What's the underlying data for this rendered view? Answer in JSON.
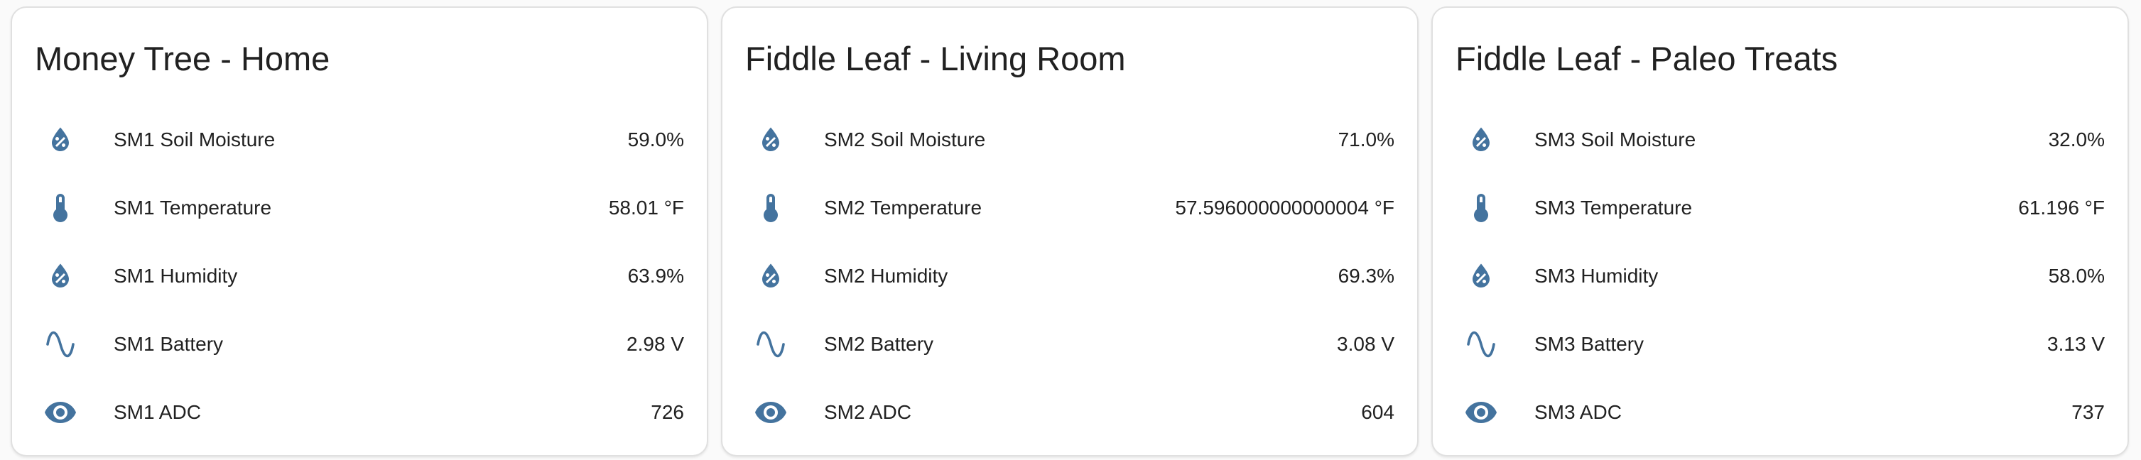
{
  "theme": {
    "icon_color": "#44739e",
    "card_background": "#ffffff",
    "page_background": "#fafafa",
    "card_border": "#e0e0e0",
    "text_color": "#212121"
  },
  "cards": [
    {
      "title": "Money Tree - Home",
      "rows": [
        {
          "icon": "water-percent-icon",
          "label": "SM1 Soil Moisture",
          "value": "59.0%"
        },
        {
          "icon": "thermometer-icon",
          "label": "SM1 Temperature",
          "value": "58.01 °F"
        },
        {
          "icon": "water-percent-icon",
          "label": "SM1 Humidity",
          "value": "63.9%"
        },
        {
          "icon": "sine-wave-icon",
          "label": "SM1 Battery",
          "value": "2.98 V"
        },
        {
          "icon": "eye-icon",
          "label": "SM1 ADC",
          "value": "726"
        }
      ]
    },
    {
      "title": "Fiddle Leaf - Living Room",
      "rows": [
        {
          "icon": "water-percent-icon",
          "label": "SM2 Soil Moisture",
          "value": "71.0%"
        },
        {
          "icon": "thermometer-icon",
          "label": "SM2 Temperature",
          "value": "57.596000000000004 °F"
        },
        {
          "icon": "water-percent-icon",
          "label": "SM2 Humidity",
          "value": "69.3%"
        },
        {
          "icon": "sine-wave-icon",
          "label": "SM2 Battery",
          "value": "3.08 V"
        },
        {
          "icon": "eye-icon",
          "label": "SM2 ADC",
          "value": "604"
        }
      ]
    },
    {
      "title": "Fiddle Leaf - Paleo Treats",
      "rows": [
        {
          "icon": "water-percent-icon",
          "label": "SM3 Soil Moisture",
          "value": "32.0%"
        },
        {
          "icon": "thermometer-icon",
          "label": "SM3 Temperature",
          "value": "61.196 °F"
        },
        {
          "icon": "water-percent-icon",
          "label": "SM3 Humidity",
          "value": "58.0%"
        },
        {
          "icon": "sine-wave-icon",
          "label": "SM3 Battery",
          "value": "3.13 V"
        },
        {
          "icon": "eye-icon",
          "label": "SM3 ADC",
          "value": "737"
        }
      ]
    }
  ]
}
